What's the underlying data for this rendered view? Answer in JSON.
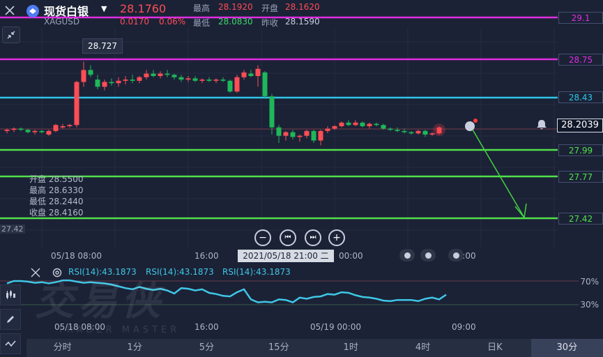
{
  "header": {
    "symbol_name": "现货白银",
    "symbol_code": "XAGUSD",
    "last_price": "28.1760",
    "change": "0.0170",
    "change_pct": "0.06%",
    "labels": {
      "high": "最高",
      "open": "开盘",
      "low": "最低",
      "prev_close": "昨收"
    },
    "high": "28.1920",
    "open": "28.1620",
    "low": "28.0830",
    "prev_close": "28.1590"
  },
  "price_levels": [
    "29.1",
    "28.75",
    "28.43",
    "27.99",
    "27.77",
    "27.42"
  ],
  "level_colors": {
    "magenta": "#e02de0",
    "cyan": "#2fc6ea",
    "green": "#52e04a"
  },
  "current_price": "28.2039",
  "high_tooltip": "28.727",
  "ohlc": {
    "open_label": "开盘",
    "open": "28.5500",
    "high_label": "最高",
    "high": "28.6330",
    "low_label": "最低",
    "low": "28.2440",
    "close_label": "收盘",
    "close": "28.4160",
    "left_axis_value": "27.42"
  },
  "time_axis": {
    "labels": [
      "05/18 08:00",
      "16:00",
      "00:00",
      "09:00"
    ],
    "crosshair": "2021/05/18 21:00 二"
  },
  "rsi": {
    "labels": [
      "RSI(14):43.1873",
      "RSI(14):43.1873",
      "RSI(14):43.1873"
    ],
    "levels": [
      "70%",
      "30%"
    ],
    "time_labels": [
      "05/18 08:00",
      "16:00",
      "05/19 00:00",
      "09:00"
    ],
    "values": [
      66,
      70,
      70,
      69,
      67,
      68,
      66,
      68,
      71,
      71,
      69,
      67,
      68,
      67,
      66,
      64,
      61,
      58,
      56,
      60,
      57,
      55,
      57,
      54,
      49,
      58,
      57,
      54,
      56,
      50,
      48,
      45,
      44,
      51,
      56,
      39,
      34,
      35,
      34,
      39,
      38,
      34,
      42,
      40,
      43,
      44,
      48,
      47,
      51,
      50,
      46,
      43,
      42,
      40,
      37,
      36,
      38,
      38,
      38,
      36,
      40,
      42,
      39,
      47
    ]
  },
  "watermark": {
    "title": "交易侠",
    "subtitle": "TRADER MASTER"
  },
  "timeframes": [
    {
      "label": "分时",
      "active": false
    },
    {
      "label": "1分",
      "active": false
    },
    {
      "label": "5分",
      "active": false
    },
    {
      "label": "15分",
      "active": false
    },
    {
      "label": "1时",
      "active": false
    },
    {
      "label": "4时",
      "active": false
    },
    {
      "label": "日K",
      "active": false
    },
    {
      "label": "30分",
      "active": true
    }
  ],
  "colors": {
    "up": "#ff4d55",
    "down": "#1fb75a",
    "rsi_line": "#3fc7e6",
    "background": "#1b2236"
  }
}
